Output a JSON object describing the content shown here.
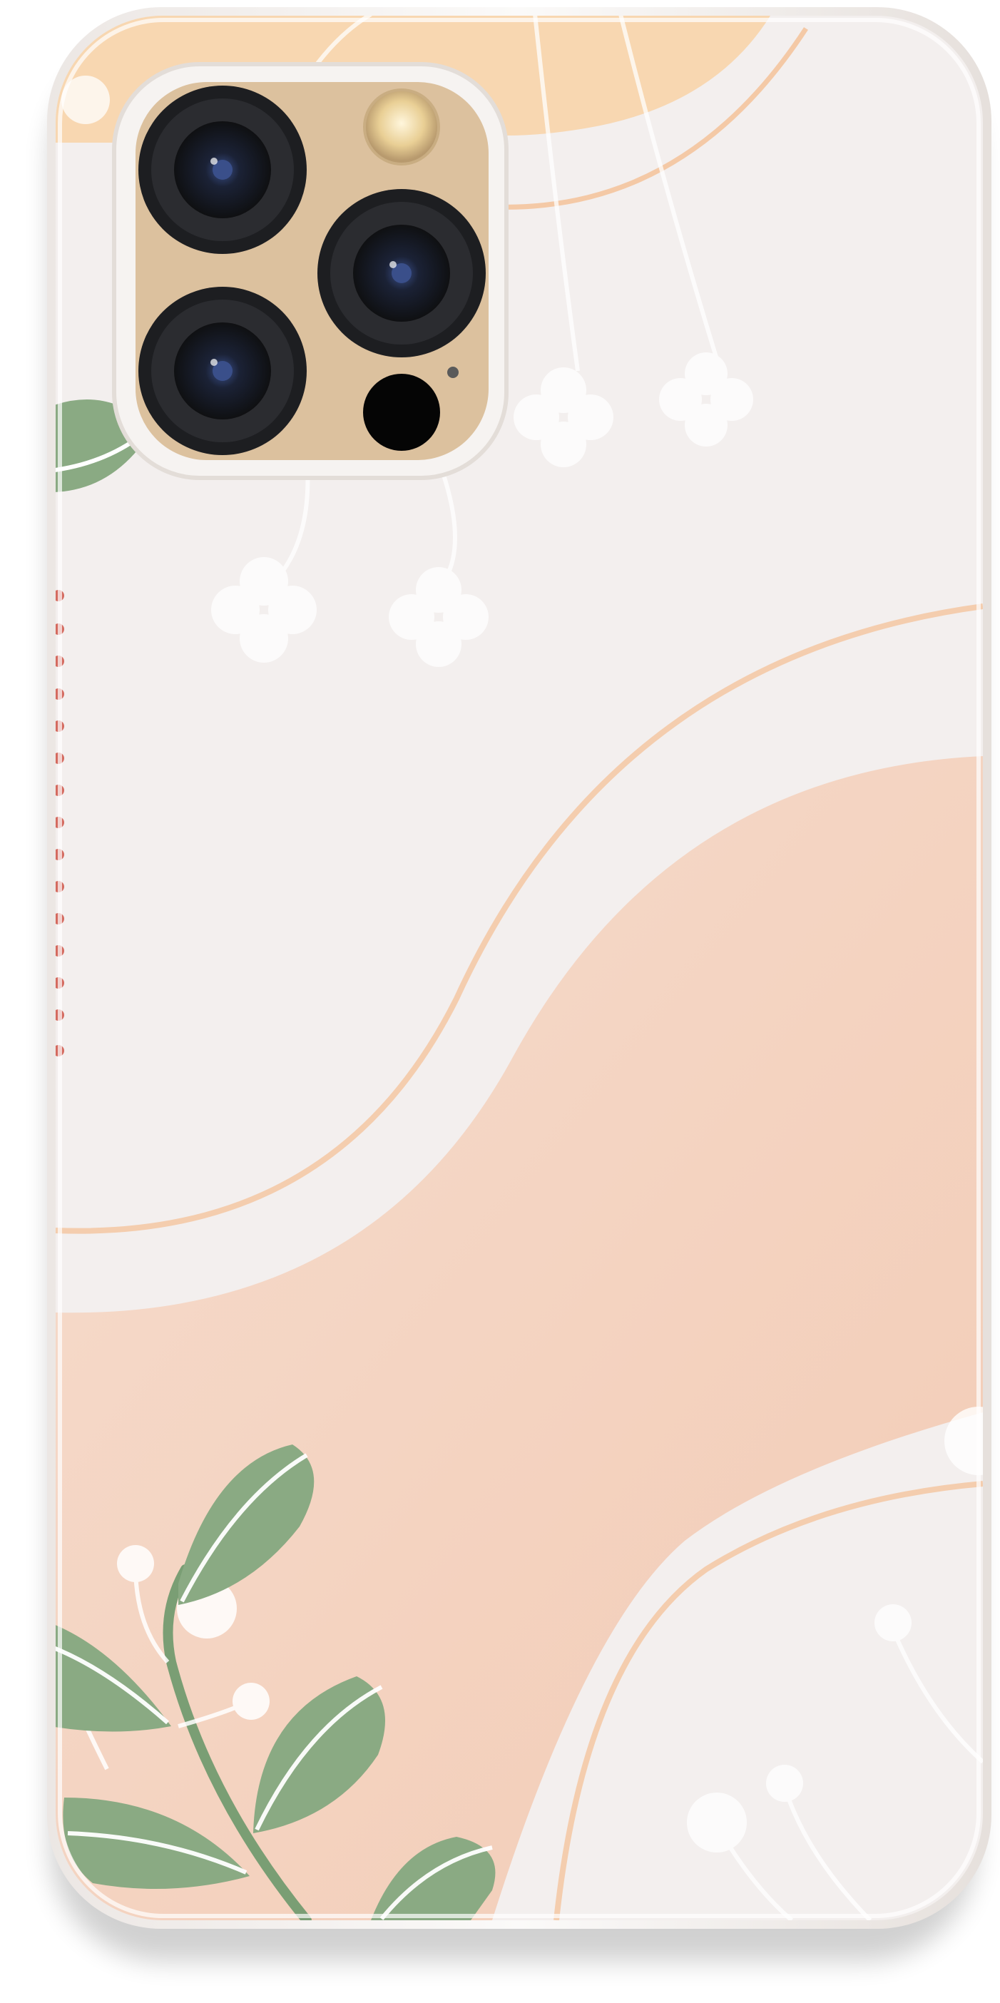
{
  "image": {
    "subject": "phone-case",
    "colors": {
      "case_base": "#f3efee",
      "peach_light": "#f6dccd",
      "peach": "#f2cbb5",
      "apricot": "#f8d2a6",
      "wave_line": "#f4c9a6",
      "leaf_green": "#8aaa83",
      "stem_green": "#7a9e74",
      "dots_red": "#d46a5f",
      "camera_gold": "#dcc19e",
      "lens_black": "#1d1e21",
      "lens_blue": "#3a4f8a",
      "flash": "#f4e3b8",
      "white": "#ffffff"
    }
  }
}
